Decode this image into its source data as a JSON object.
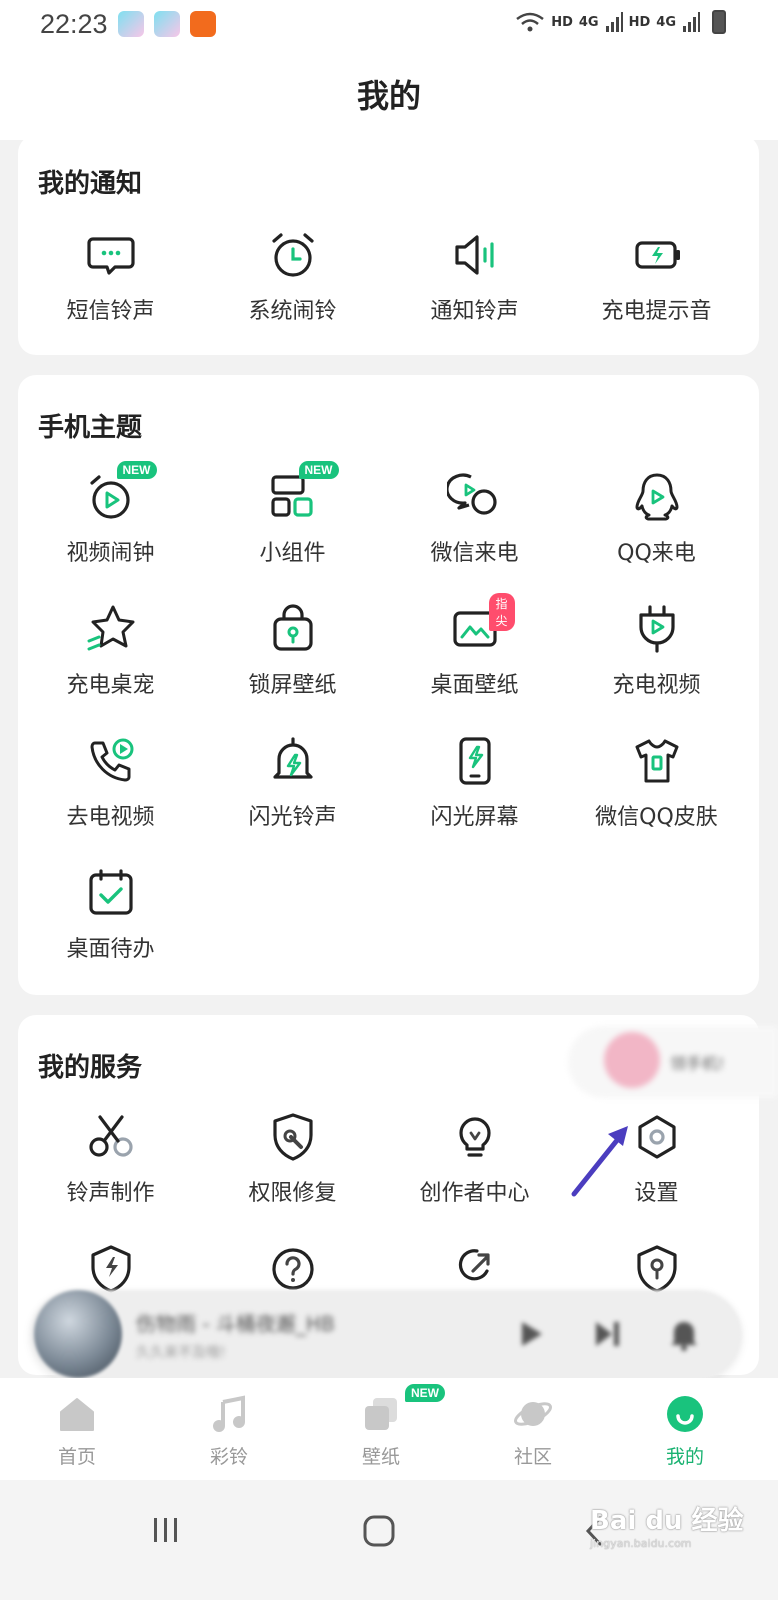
{
  "status_bar": {
    "time": "22:23",
    "network_1": "HD",
    "signal_1": "4G",
    "network_2": "HD",
    "signal_2": "4G"
  },
  "header": {
    "title": "我的"
  },
  "notifications": {
    "title": "我的通知",
    "items": [
      {
        "label": "短信铃声",
        "icon": "sms-bubble-icon"
      },
      {
        "label": "系统闹铃",
        "icon": "alarm-clock-icon"
      },
      {
        "label": "通知铃声",
        "icon": "speaker-icon"
      },
      {
        "label": "充电提示音",
        "icon": "battery-charge-icon"
      }
    ]
  },
  "themes": {
    "title": "手机主题",
    "items": [
      {
        "label": "视频闹钟",
        "icon": "video-alarm-icon",
        "badge": "NEW"
      },
      {
        "label": "小组件",
        "icon": "widget-grid-icon",
        "badge": "NEW"
      },
      {
        "label": "微信来电",
        "icon": "wechat-call-icon"
      },
      {
        "label": "QQ来电",
        "icon": "qq-penguin-icon"
      },
      {
        "label": "充电桌宠",
        "icon": "star-pet-icon"
      },
      {
        "label": "锁屏壁纸",
        "icon": "lock-wallpaper-icon"
      },
      {
        "label": "桌面壁纸",
        "icon": "desktop-wallpaper-icon",
        "badge": "指尖"
      },
      {
        "label": "充电视频",
        "icon": "charging-plug-icon"
      },
      {
        "label": "去电视频",
        "icon": "outgoing-call-video-icon"
      },
      {
        "label": "闪光铃声",
        "icon": "flash-bell-icon"
      },
      {
        "label": "闪光屏幕",
        "icon": "flash-screen-icon"
      },
      {
        "label": "微信QQ皮肤",
        "icon": "tshirt-skin-icon"
      },
      {
        "label": "桌面待办",
        "icon": "calendar-todo-icon"
      }
    ]
  },
  "services": {
    "title": "我的服务",
    "items": [
      {
        "label": "铃声制作",
        "icon": "scissors-icon"
      },
      {
        "label": "权限修复",
        "icon": "shield-wrench-icon"
      },
      {
        "label": "创作者中心",
        "icon": "lightbulb-icon"
      },
      {
        "label": "设置",
        "icon": "settings-hexagon-icon"
      }
    ],
    "partial_icons": [
      "shield-bolt-icon",
      "help-circle-icon",
      "share-arrow-icon",
      "location-shield-icon"
    ]
  },
  "floating_ad": {
    "text": "领手机!"
  },
  "player": {
    "title": "伤物雨 - 斗桶夜邂_HB",
    "subtitle": "久久来不及哦!"
  },
  "tabbar": {
    "tabs": [
      {
        "label": "首页",
        "icon": "home-icon"
      },
      {
        "label": "彩铃",
        "icon": "music-note-icon"
      },
      {
        "label": "壁纸",
        "icon": "wallpaper-icon",
        "badge": "NEW"
      },
      {
        "label": "社区",
        "icon": "planet-icon"
      },
      {
        "label": "我的",
        "icon": "smile-face-icon",
        "active": true
      }
    ]
  },
  "watermark": {
    "brand": "Bai du 经验",
    "url": "jingyan.baidu.com"
  },
  "colors": {
    "accent": "#19c37d",
    "text": "#333333",
    "badge_hot": "#ff4d6d",
    "annotation_arrow": "#4b3dbf"
  }
}
